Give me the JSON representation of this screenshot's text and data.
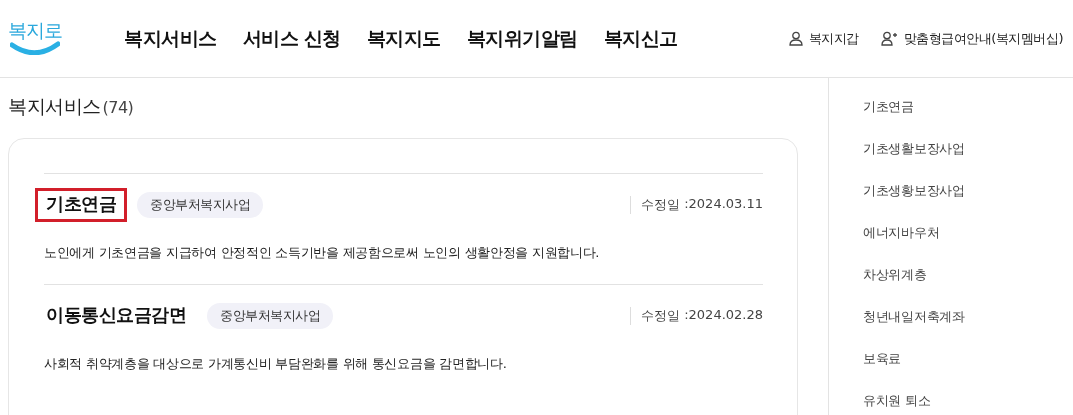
{
  "header": {
    "logo": "복지로",
    "nav": [
      {
        "label": "복지서비스"
      },
      {
        "label": "서비스 신청"
      },
      {
        "label": "복지지도"
      },
      {
        "label": "복지위기알림"
      },
      {
        "label": "복지신고"
      }
    ],
    "utility_links": [
      {
        "kind": "user",
        "label": "복지지갑"
      },
      {
        "kind": "user-add",
        "label": "맞춤형급여안내(복지멤버십)"
      }
    ]
  },
  "heading": {
    "title": "복지서비스",
    "count": "(74)"
  },
  "services": [
    {
      "title": "기초연금",
      "highlighted": true,
      "tag": "중앙부처복지사업",
      "date_label": "수정일",
      "date": ":2024.03.11",
      "description": "노인에게 기초연금을 지급하여 안정적인 소득기반을 제공함으로써 노인의 생활안정을 지원합니다."
    },
    {
      "title": "이동통신요금감면",
      "highlighted": false,
      "tag": "중앙부처복지사업",
      "date_label": "수정일",
      "date": ":2024.02.28",
      "description": "사회적 취약계층을 대상으로 가계통신비 부담완화를 위해 통신요금을 감면합니다."
    }
  ],
  "sidebar": {
    "items": [
      "기초연금",
      "기초생활보장사업",
      "기초생황보장사업",
      "에너지바우처",
      "차상위계층",
      "청년내일저축계좌",
      "보육료",
      "유치원 퇴소"
    ]
  }
}
